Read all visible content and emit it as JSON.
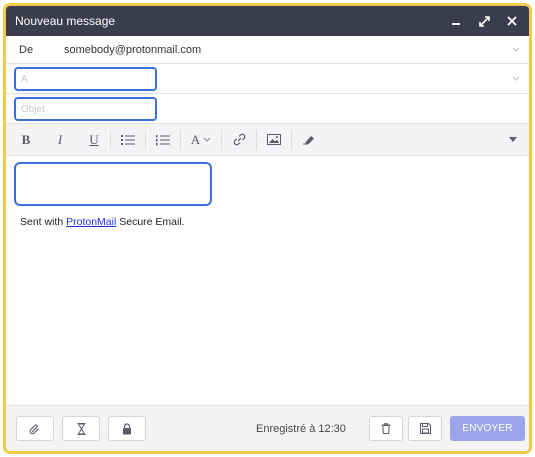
{
  "window": {
    "title": "Nouveau message",
    "accent_color": "#f2c94c",
    "titlebar_color": "#3c3c4f"
  },
  "from": {
    "label": "De",
    "address": "somebody@protonmail.com"
  },
  "to": {
    "placeholder": "À"
  },
  "subject": {
    "placeholder": "Objet"
  },
  "toolbar": {
    "font_label": "A"
  },
  "signature": {
    "prefix": "Sent with ",
    "link": "ProtonMail",
    "suffix": " Secure Email."
  },
  "footer": {
    "saved_status": "Enregistré à 12:30",
    "send_label": "ENVOYER",
    "send_color": "#9da5ea"
  },
  "icons": [
    "minimize-icon",
    "expand-icon",
    "close-icon",
    "chevron-down-icon",
    "unordered-list-icon",
    "ordered-list-icon",
    "link-icon",
    "image-icon",
    "eraser-icon",
    "paperclip-icon",
    "hourglass-icon",
    "lock-icon",
    "trash-icon",
    "save-icon"
  ]
}
